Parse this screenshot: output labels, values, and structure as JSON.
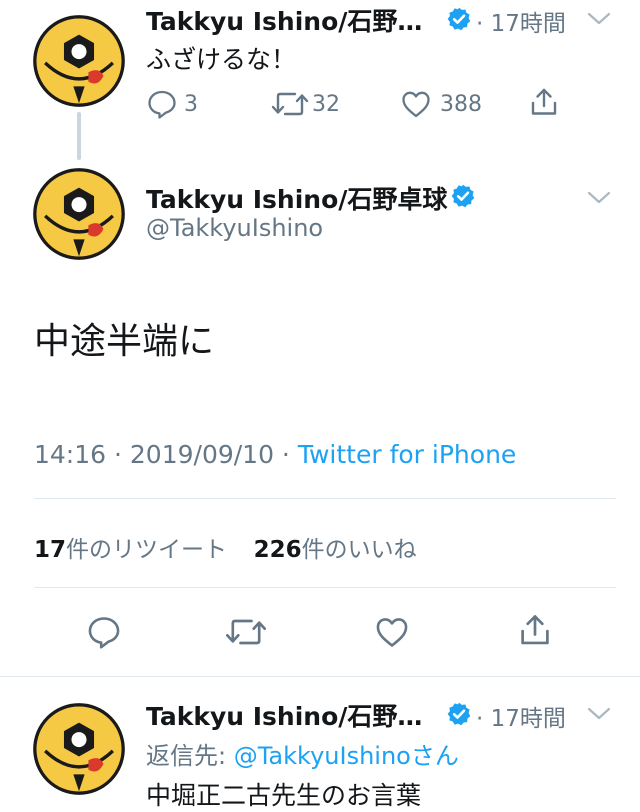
{
  "tweet1": {
    "name": "Takkyu Ishino/石野…",
    "time": "· 17時間",
    "text": "ふざけるな！",
    "replies": "3",
    "retweets": "32",
    "likes": "388"
  },
  "main": {
    "name": "Takkyu Ishino/石野卓球",
    "handle": "@TakkyuIshino",
    "text": "中途半端に",
    "time": "14:16",
    "date": "· 2019/09/10 ·",
    "source": "Twitter for iPhone",
    "retweet_count": "17",
    "retweet_label": "件のリツイート",
    "like_count": "226",
    "like_label": "件のいいね"
  },
  "tweet3": {
    "name": "Takkyu Ishino/石野…",
    "time": "· 17時間",
    "reply_prefix": "返信先:",
    "reply_handle": "@TakkyuIshinoさん",
    "text_partial": "中堀正二古先生のお言葉"
  },
  "colors": {
    "accent": "#1da1f2",
    "verified": "#1da1f2",
    "secondary_text": "#657786",
    "avatar_yellow": "#f6c945"
  },
  "icons": [
    "reply-icon",
    "retweet-icon",
    "like-icon",
    "share-icon",
    "verified-icon",
    "chevron-down-icon"
  ]
}
